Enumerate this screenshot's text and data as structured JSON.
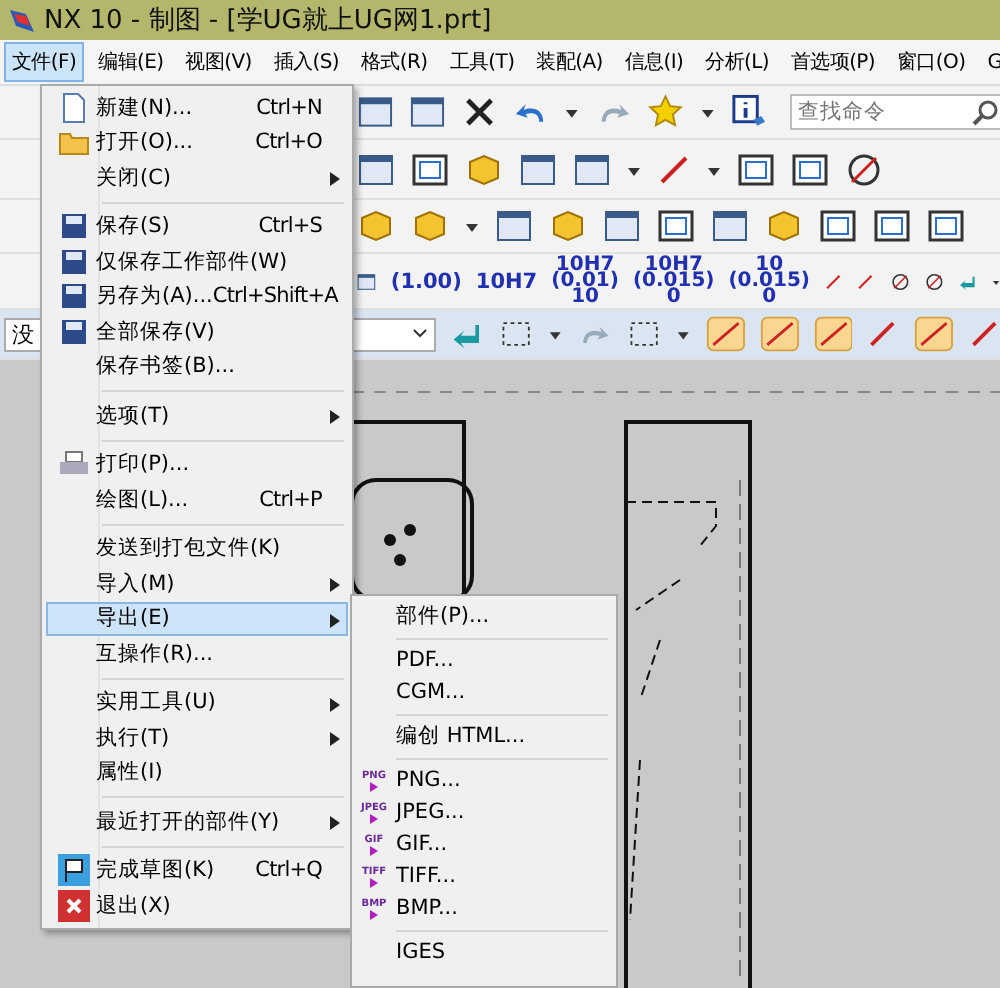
{
  "window": {
    "title": "NX 10 - 制图 - [学UG就上UG网1.prt]"
  },
  "menubar": [
    {
      "label": "文件(F)",
      "selected": true
    },
    {
      "label": "编辑(E)",
      "selected": false
    },
    {
      "label": "视图(V)",
      "selected": false
    },
    {
      "label": "插入(S)",
      "selected": false
    },
    {
      "label": "格式(R)",
      "selected": false
    },
    {
      "label": "工具(T)",
      "selected": false
    },
    {
      "label": "装配(A)",
      "selected": false
    },
    {
      "label": "信息(I)",
      "selected": false
    },
    {
      "label": "分析(L)",
      "selected": false
    },
    {
      "label": "首选项(P)",
      "selected": false
    },
    {
      "label": "窗口(O)",
      "selected": false
    },
    {
      "label": "G",
      "selected": false
    }
  ],
  "search": {
    "placeholder": "查找命令"
  },
  "dimension_buttons": [
    {
      "lines": [
        "(1.00)"
      ]
    },
    {
      "lines": [
        "10H7"
      ]
    },
    {
      "lines": [
        "10H7",
        "(0.01)",
        "10"
      ]
    },
    {
      "lines": [
        "10H7",
        "(0.015)",
        "0"
      ]
    },
    {
      "lines": [
        "10",
        "(0.015)",
        "0"
      ]
    }
  ],
  "filter_combo": {
    "value": "没"
  },
  "file_menu": [
    {
      "kind": "item",
      "label": "新建(N)...",
      "shortcut": "Ctrl+N",
      "submenu": false,
      "selected": false
    },
    {
      "kind": "item",
      "label": "打开(O)...",
      "shortcut": "Ctrl+O",
      "submenu": false,
      "selected": false
    },
    {
      "kind": "item",
      "label": "关闭(C)",
      "submenu": true,
      "selected": false
    },
    {
      "kind": "separator"
    },
    {
      "kind": "item",
      "label": "保存(S)",
      "shortcut": "Ctrl+S",
      "submenu": false,
      "selected": false
    },
    {
      "kind": "item",
      "label": "仅保存工作部件(W)",
      "submenu": false,
      "selected": false
    },
    {
      "kind": "item",
      "label": "另存为(A)...",
      "shortcut": "Ctrl+Shift+A",
      "submenu": false,
      "selected": false
    },
    {
      "kind": "item",
      "label": "全部保存(V)",
      "submenu": false,
      "selected": false
    },
    {
      "kind": "item",
      "label": "保存书签(B)...",
      "submenu": false,
      "selected": false
    },
    {
      "kind": "separator"
    },
    {
      "kind": "item",
      "label": "选项(T)",
      "submenu": true,
      "selected": false
    },
    {
      "kind": "separator"
    },
    {
      "kind": "item",
      "label": "打印(P)...",
      "submenu": false,
      "selected": false
    },
    {
      "kind": "item",
      "label": "绘图(L)...",
      "shortcut": "Ctrl+P",
      "submenu": false,
      "selected": false
    },
    {
      "kind": "separator"
    },
    {
      "kind": "item",
      "label": "发送到打包文件(K)",
      "submenu": false,
      "selected": false
    },
    {
      "kind": "item",
      "label": "导入(M)",
      "submenu": true,
      "selected": false
    },
    {
      "kind": "item",
      "label": "导出(E)",
      "submenu": true,
      "selected": true
    },
    {
      "kind": "item",
      "label": "互操作(R)...",
      "submenu": false,
      "selected": false
    },
    {
      "kind": "separator"
    },
    {
      "kind": "item",
      "label": "实用工具(U)",
      "submenu": true,
      "selected": false
    },
    {
      "kind": "item",
      "label": "执行(T)",
      "submenu": true,
      "selected": false
    },
    {
      "kind": "item",
      "label": "属性(I)",
      "submenu": false,
      "selected": false
    },
    {
      "kind": "separator"
    },
    {
      "kind": "item",
      "label": "最近打开的部件(Y)",
      "submenu": true,
      "selected": false
    },
    {
      "kind": "separator"
    },
    {
      "kind": "item",
      "label": "完成草图(K)",
      "shortcut": "Ctrl+Q",
      "submenu": false,
      "selected": false
    },
    {
      "kind": "item",
      "label": "退出(X)",
      "submenu": false,
      "selected": false
    }
  ],
  "export_menu": [
    {
      "kind": "item",
      "label": "部件(P)..."
    },
    {
      "kind": "separator"
    },
    {
      "kind": "item",
      "label": "PDF..."
    },
    {
      "kind": "item",
      "label": "CGM..."
    },
    {
      "kind": "separator"
    },
    {
      "kind": "item",
      "label": "编创 HTML..."
    },
    {
      "kind": "separator"
    },
    {
      "kind": "item",
      "label": "PNG...",
      "badge": "PNG"
    },
    {
      "kind": "item",
      "label": "JPEG...",
      "badge": "JPEG"
    },
    {
      "kind": "item",
      "label": "GIF...",
      "badge": "GIF"
    },
    {
      "kind": "item",
      "label": "TIFF...",
      "badge": "TIFF"
    },
    {
      "kind": "item",
      "label": "BMP...",
      "badge": "BMP"
    },
    {
      "kind": "separator"
    },
    {
      "kind": "item",
      "label": "IGES"
    }
  ]
}
